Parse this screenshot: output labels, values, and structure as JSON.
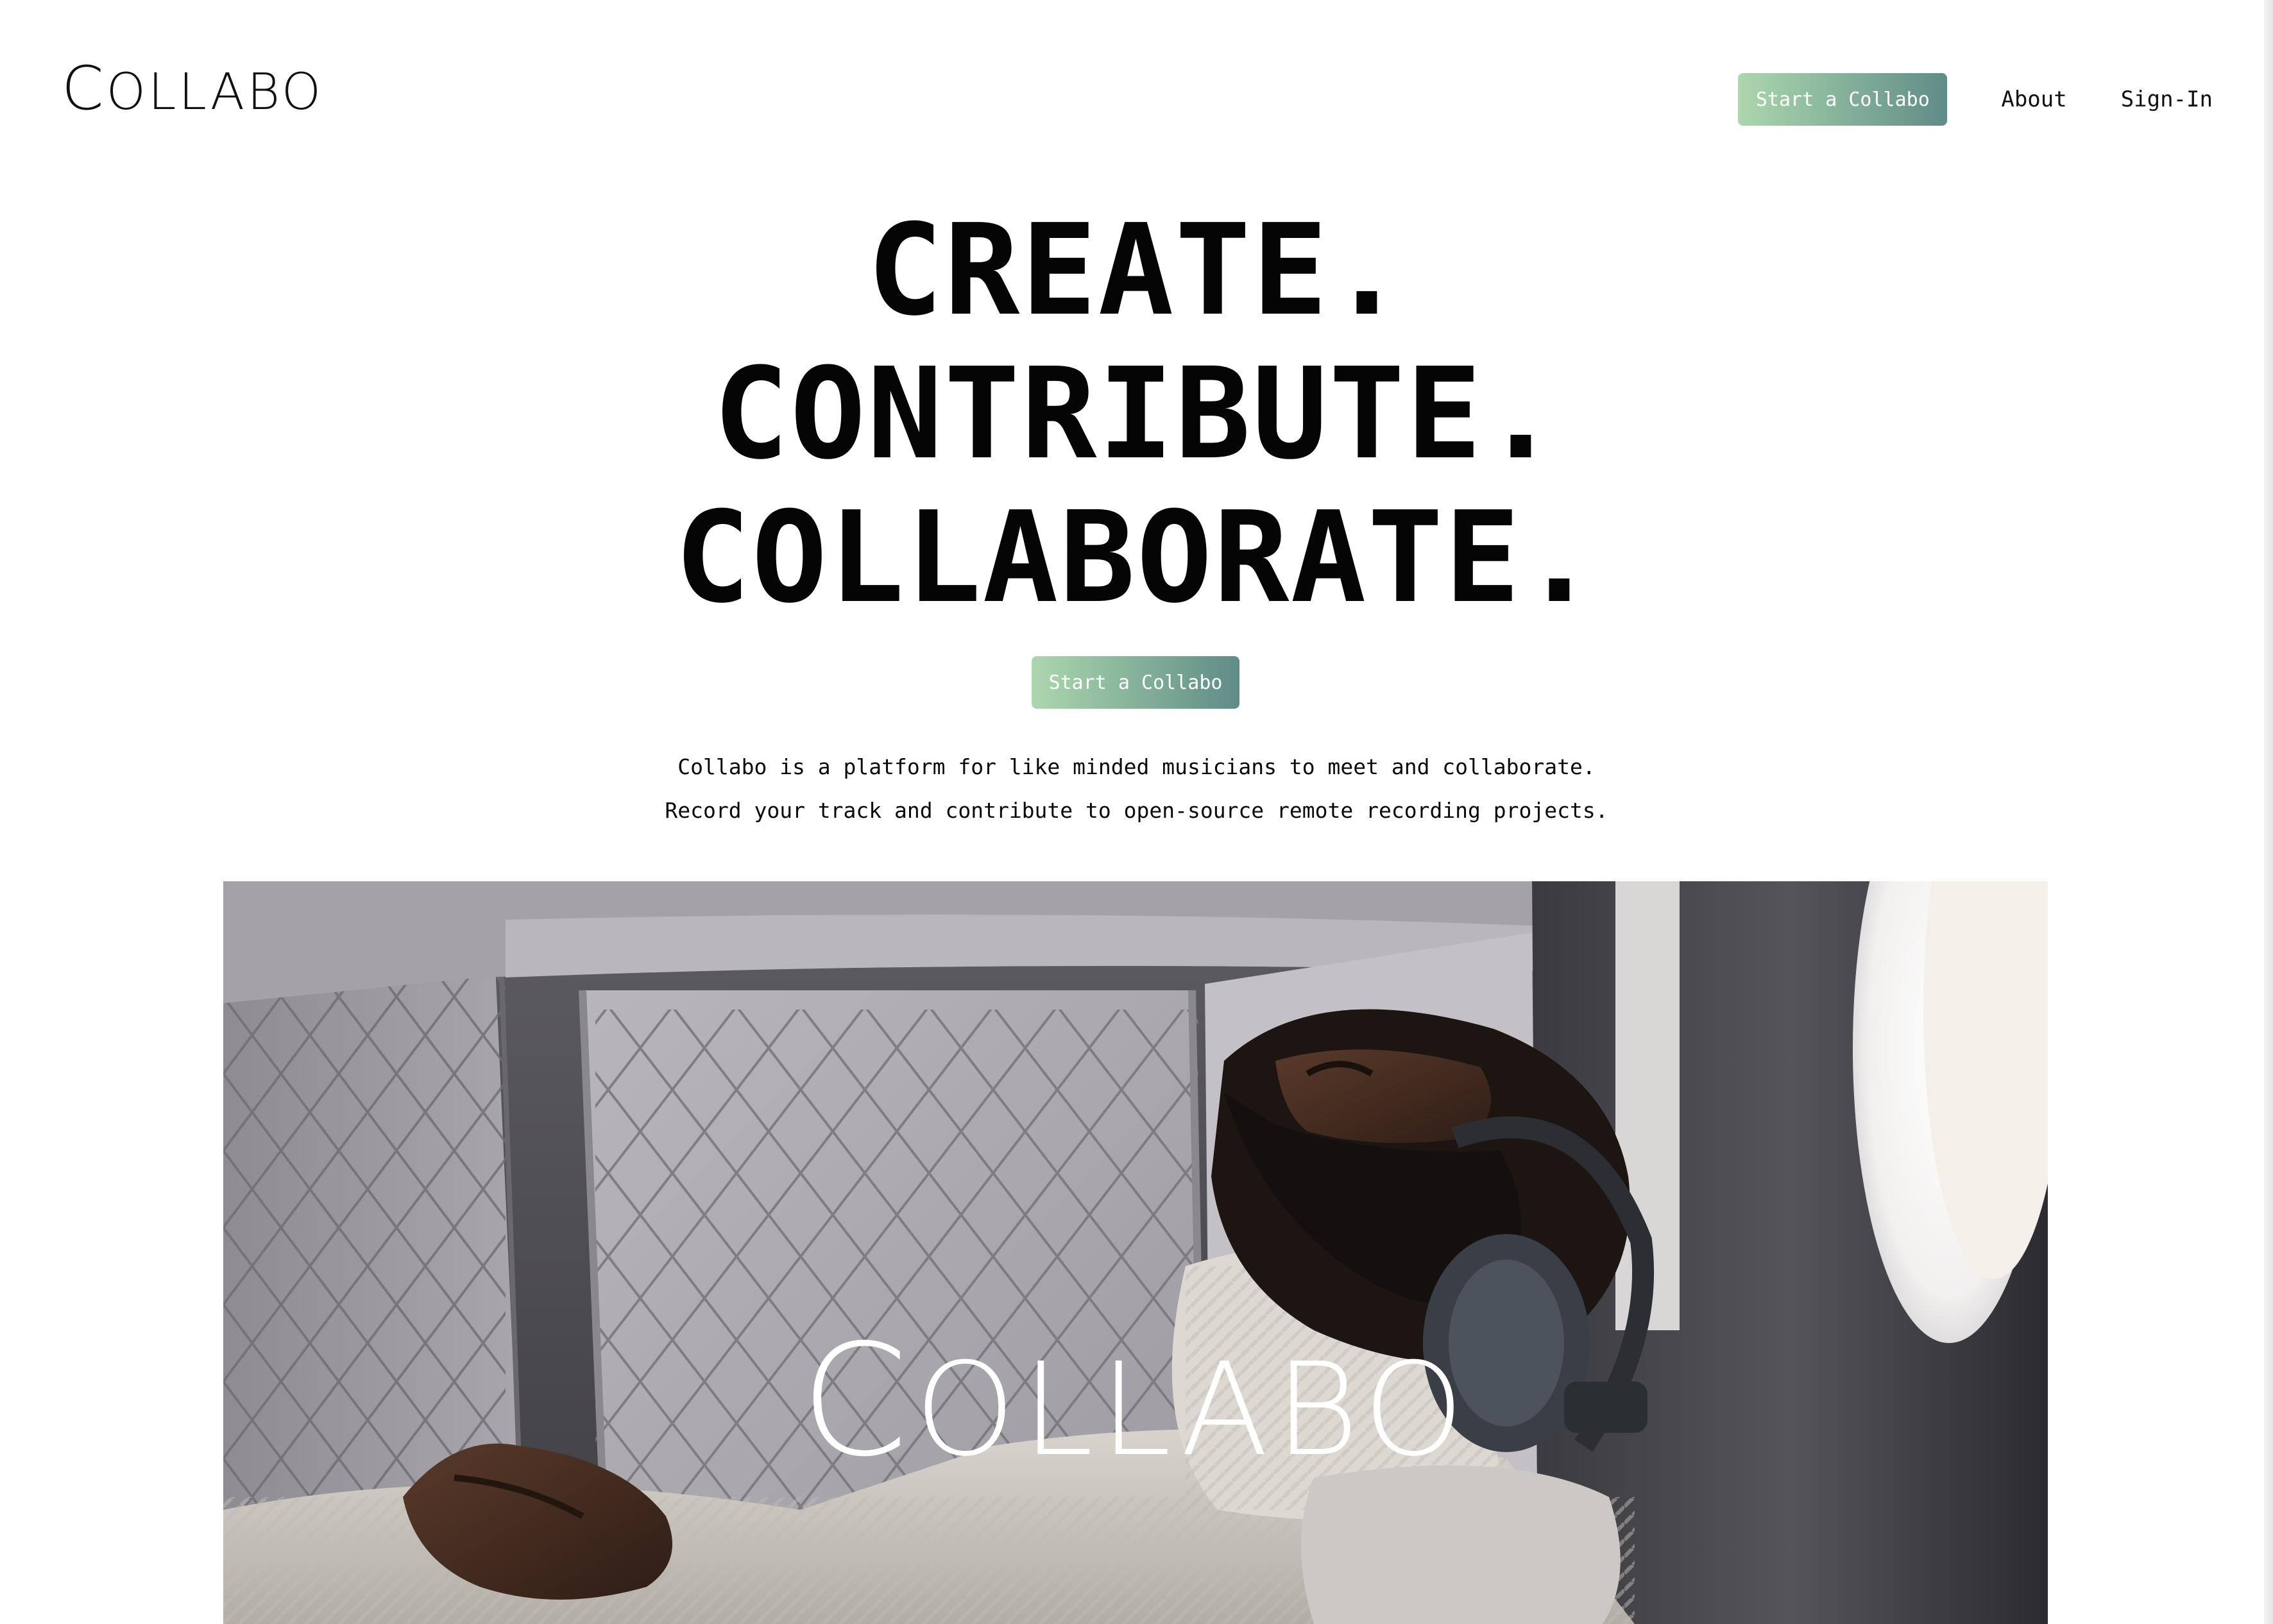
{
  "header": {
    "logo_text": "Collabo",
    "nav": {
      "cta_label": "Start a Collabo",
      "about_label": "About",
      "signin_label": "Sign-In"
    }
  },
  "hero": {
    "lines": [
      "CREATE.",
      "CONTRIBUTE.",
      "COLLABORATE."
    ],
    "cta_label": "Start a Collabo",
    "tagline": [
      "Collabo is a platform for like minded musicians to meet and collaborate.",
      "Record your track and contribute to open-source remote recording projects."
    ]
  },
  "hero_image": {
    "overlay_logo_text": "Collabo",
    "subject": "man-with-headphones-reclining-in-jet-seat"
  },
  "colors": {
    "button_gradient_start": "#acd7ae",
    "button_gradient_end": "#5f8c87",
    "text": "#0a0a0a",
    "background": "#ffffff"
  }
}
